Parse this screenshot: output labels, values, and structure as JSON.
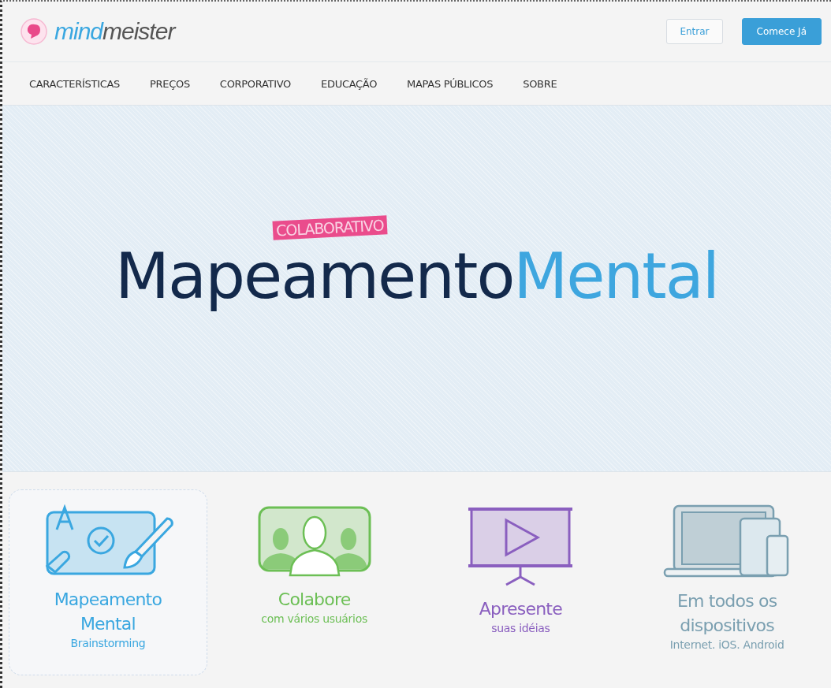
{
  "header": {
    "logo": {
      "lead": "mind",
      "tail": "meister"
    },
    "buttons": [
      {
        "label": "Entrar",
        "kind": "outline"
      },
      {
        "label": "Comece Já",
        "kind": "primary"
      }
    ]
  },
  "nav": {
    "items": [
      "CARACTERÍSTICAS",
      "PREÇOS",
      "CORPORATIVO",
      "EDUCAÇÃO",
      "MAPAS PÚBLICOS",
      "SOBRE"
    ]
  },
  "hero": {
    "badge": "COLABORATIVO",
    "title_dark": "Mapeamento",
    "title_light": "Mental"
  },
  "features": [
    {
      "kind": "mindmap",
      "title": "Mapeamento Mental",
      "subtitle": "Brainstorming",
      "color": "#3aa7e0",
      "selected": true
    },
    {
      "kind": "collaborate",
      "title": "Colabore",
      "subtitle": "com vários usuários",
      "color": "#6cbf55",
      "selected": false
    },
    {
      "kind": "present",
      "title": "Apresente",
      "subtitle": "suas idéias",
      "color": "#8a5fbf",
      "selected": false
    },
    {
      "kind": "devices",
      "title": "Em todos os dispositivos",
      "subtitle": "Internet. iOS. Android",
      "color": "#7a9fb0",
      "selected": false
    }
  ]
}
